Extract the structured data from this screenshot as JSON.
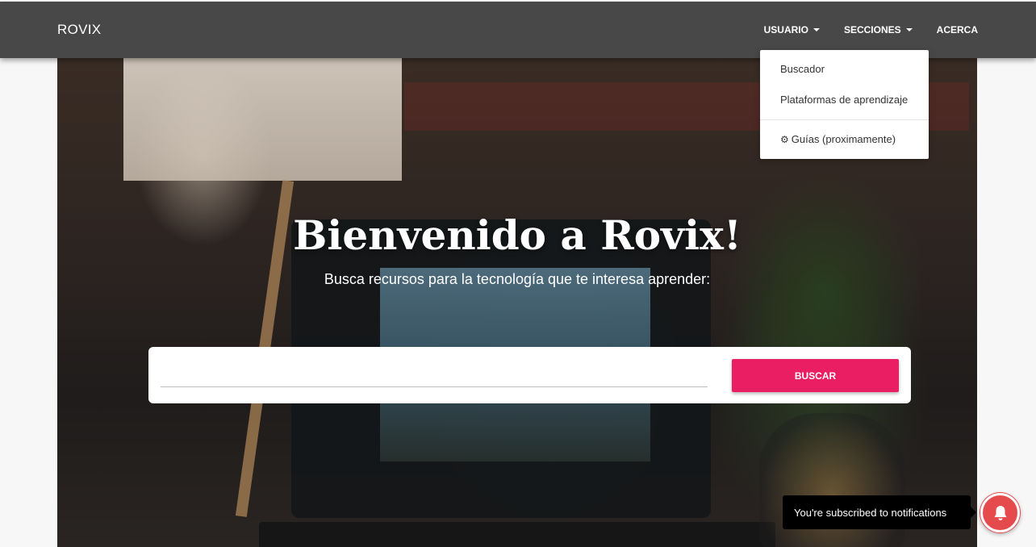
{
  "navbar": {
    "brand": "ROVIX",
    "items": [
      {
        "label": "USUARIO",
        "has_caret": true
      },
      {
        "label": "SECCIONES",
        "has_caret": true
      },
      {
        "label": "ACERCA",
        "has_caret": false
      }
    ]
  },
  "dropdown": {
    "items": [
      {
        "label": "Buscador"
      },
      {
        "label": "Plataformas de aprendizaje"
      },
      {
        "label": "Guías (proximamente)",
        "icon": "gear-icon"
      }
    ]
  },
  "hero": {
    "title": "Bienvenido a Rovix!",
    "subtitle": "Busca recursos para la tecnología que te interesa aprender:"
  },
  "search": {
    "value": "",
    "button_label": "BUSCAR"
  },
  "notification": {
    "toast_text": "You're subscribed to notifications",
    "icon": "bell-icon"
  },
  "colors": {
    "navbar_bg": "#484848",
    "accent": "#e91e63",
    "bell_bg": "#e54b4d"
  }
}
